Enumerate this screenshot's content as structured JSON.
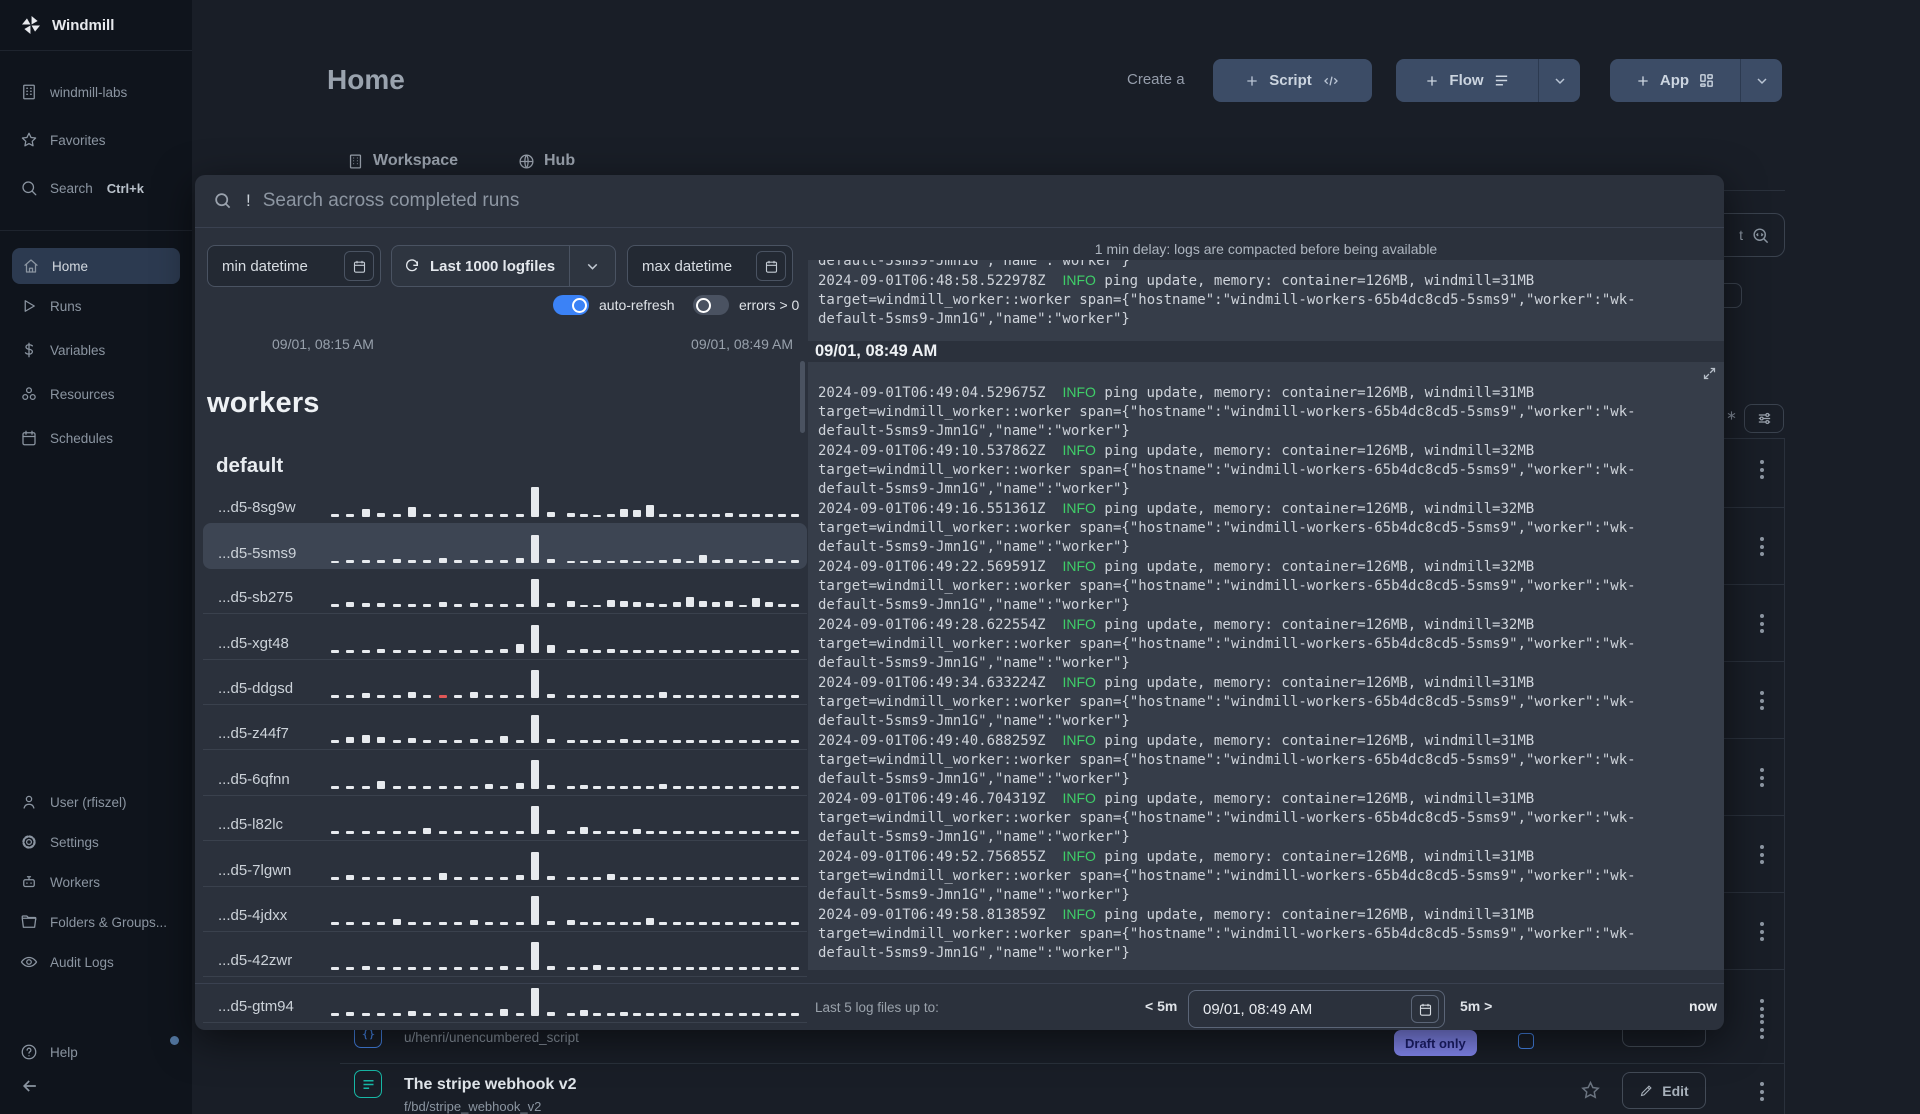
{
  "sidebar": {
    "logo_label": "Windmill",
    "top_items": [
      {
        "icon": "building",
        "label": "windmill-labs"
      },
      {
        "icon": "star",
        "label": "Favorites"
      },
      {
        "icon": "search",
        "label": "Search",
        "kbd": "Ctrl+k"
      }
    ],
    "main_items": [
      {
        "icon": "home",
        "label": "Home",
        "active": true
      },
      {
        "icon": "play",
        "label": "Runs"
      },
      {
        "icon": "dollar",
        "label": "Variables"
      },
      {
        "icon": "resources",
        "label": "Resources"
      },
      {
        "icon": "calendar",
        "label": "Schedules"
      }
    ],
    "bottom_items": [
      {
        "icon": "user",
        "label": "User (rfiszel)"
      },
      {
        "icon": "gear",
        "label": "Settings"
      },
      {
        "icon": "robot",
        "label": "Workers"
      },
      {
        "icon": "folder",
        "label": "Folders & Groups..."
      },
      {
        "icon": "eye",
        "label": "Audit Logs"
      }
    ],
    "help_label": "Help"
  },
  "header": {
    "title": "Home",
    "create_label": "Create a",
    "script_label": "Script",
    "flow_label": "Flow",
    "app_label": "App"
  },
  "tabs": {
    "workspace": "Workspace",
    "hub": "Hub"
  },
  "background": {
    "search_char": "t",
    "row_a_path": "u/henri/unencumbered_script",
    "row_a_badge": "Draft only",
    "row_b_title": "The stripe webhook v2",
    "row_b_path": "f/bd/stripe_webhook_v2",
    "edit_label": "Edit"
  },
  "modal": {
    "search_prefix": "!",
    "search_placeholder": "Search across completed runs",
    "filters": {
      "min_label": "min datetime",
      "logfiles_label": "Last 1000 logfiles",
      "max_label": "max datetime"
    },
    "toggles": {
      "auto_label": "auto-refresh",
      "errors_label": "errors > 0"
    },
    "range": {
      "start": "09/01, 08:15 AM",
      "end": "09/01, 08:49 AM"
    },
    "workers_title": "workers",
    "group_title": "default",
    "workers": [
      {
        "name": "...d5-8sg9w",
        "bars": [
          3,
          3,
          8,
          4,
          3,
          10,
          3,
          3,
          3,
          3,
          3,
          3,
          3,
          30,
          5,
          4,
          3,
          2,
          3,
          8,
          7,
          12,
          3,
          3,
          3,
          3,
          3,
          4,
          3,
          3,
          3,
          3,
          3
        ]
      },
      {
        "name": "...d5-5sms9",
        "highlight": true,
        "bars": [
          2,
          3,
          3,
          3,
          4,
          3,
          3,
          5,
          3,
          3,
          3,
          3,
          5,
          28,
          4,
          2,
          2,
          3,
          2,
          3,
          2,
          2,
          3,
          4,
          2,
          8,
          3,
          4,
          3,
          2,
          4,
          2,
          3
        ]
      },
      {
        "name": "...d5-sb275",
        "bars": [
          3,
          5,
          4,
          4,
          3,
          3,
          3,
          5,
          3,
          4,
          3,
          3,
          3,
          28,
          4,
          6,
          2,
          2,
          7,
          6,
          5,
          4,
          3,
          5,
          10,
          6,
          5,
          6,
          2,
          9,
          5,
          3,
          3
        ]
      },
      {
        "name": "...d5-xgt48",
        "bars": [
          3,
          3,
          3,
          4,
          3,
          3,
          3,
          3,
          3,
          3,
          3,
          4,
          9,
          28,
          8,
          3,
          4,
          3,
          4,
          3,
          3,
          3,
          3,
          3,
          3,
          3,
          3,
          3,
          3,
          3,
          3,
          3,
          3
        ]
      },
      {
        "name": "...d5-ddgsd",
        "err": 7,
        "bars": [
          3,
          3,
          5,
          3,
          3,
          6,
          3,
          3,
          3,
          6,
          3,
          3,
          3,
          28,
          4,
          3,
          3,
          3,
          3,
          3,
          3,
          3,
          6,
          3,
          3,
          3,
          3,
          3,
          3,
          3,
          3,
          3,
          3
        ]
      },
      {
        "name": "...d5-z44f7",
        "bars": [
          3,
          6,
          8,
          6,
          3,
          5,
          3,
          3,
          3,
          4,
          3,
          7,
          3,
          28,
          4,
          3,
          3,
          3,
          3,
          4,
          3,
          3,
          3,
          3,
          3,
          3,
          3,
          3,
          3,
          3,
          3,
          3,
          3
        ]
      },
      {
        "name": "...d5-6qfnn",
        "bars": [
          3,
          3,
          3,
          8,
          3,
          3,
          3,
          3,
          3,
          3,
          5,
          3,
          6,
          29,
          4,
          3,
          4,
          3,
          3,
          3,
          3,
          3,
          5,
          3,
          3,
          3,
          3,
          3,
          3,
          3,
          3,
          3,
          3
        ]
      },
      {
        "name": "...d5-l82lc",
        "bars": [
          3,
          3,
          3,
          3,
          3,
          3,
          6,
          3,
          3,
          3,
          3,
          3,
          3,
          28,
          4,
          3,
          7,
          3,
          3,
          3,
          5,
          3,
          3,
          3,
          3,
          3,
          3,
          3,
          3,
          3,
          3,
          3,
          3
        ]
      },
      {
        "name": "...d5-7lgwn",
        "bars": [
          3,
          5,
          3,
          3,
          3,
          3,
          3,
          7,
          3,
          3,
          3,
          3,
          5,
          28,
          4,
          3,
          3,
          3,
          6,
          3,
          3,
          3,
          3,
          3,
          3,
          3,
          3,
          3,
          3,
          3,
          3,
          3,
          3
        ]
      },
      {
        "name": "...d5-4jdxx",
        "bars": [
          3,
          3,
          3,
          3,
          6,
          3,
          3,
          3,
          3,
          5,
          3,
          3,
          3,
          29,
          4,
          5,
          3,
          3,
          3,
          3,
          3,
          7,
          3,
          3,
          3,
          3,
          3,
          3,
          3,
          3,
          3,
          3,
          3
        ]
      },
      {
        "name": "...d5-42zwr",
        "bars": [
          3,
          3,
          4,
          3,
          3,
          3,
          3,
          3,
          3,
          3,
          3,
          4,
          3,
          28,
          4,
          3,
          3,
          5,
          3,
          3,
          3,
          3,
          3,
          3,
          3,
          3,
          3,
          3,
          3,
          3,
          3,
          3,
          3
        ]
      },
      {
        "name": "...d5-gtm94",
        "bars": [
          3,
          4,
          3,
          3,
          3,
          5,
          3,
          3,
          3,
          3,
          3,
          7,
          3,
          28,
          4,
          3,
          6,
          3,
          3,
          4,
          3,
          3,
          3,
          3,
          3,
          3,
          3,
          3,
          3,
          3,
          3,
          3,
          3
        ]
      }
    ],
    "logs": {
      "delay_note": "1 min delay: logs are compacted before being available",
      "section_header": "09/01, 08:49 AM",
      "info_label": "INFO",
      "line1_mid": " ping update, memory: container=126MB, windmill=",
      "line2": "target=windmill_worker::worker span={\"hostname\":\"windmill-workers-65b4dc8cd5-5sms9\",\"worker\":\"wk-",
      "line3": "default-5sms9-Jmn1G\",\"name\":\"worker\"}",
      "top_entry": {
        "ts": "2024-09-01T06:48:58.522978Z",
        "mem": "31MB"
      },
      "entries": [
        {
          "ts": "2024-09-01T06:49:04.529675Z",
          "mem": "31MB"
        },
        {
          "ts": "2024-09-01T06:49:10.537862Z",
          "mem": "32MB"
        },
        {
          "ts": "2024-09-01T06:49:16.551361Z",
          "mem": "32MB"
        },
        {
          "ts": "2024-09-01T06:49:22.569591Z",
          "mem": "32MB"
        },
        {
          "ts": "2024-09-01T06:49:28.622554Z",
          "mem": "32MB"
        },
        {
          "ts": "2024-09-01T06:49:34.633224Z",
          "mem": "31MB"
        },
        {
          "ts": "2024-09-01T06:49:40.688259Z",
          "mem": "31MB"
        },
        {
          "ts": "2024-09-01T06:49:46.704319Z",
          "mem": "31MB"
        },
        {
          "ts": "2024-09-01T06:49:52.756855Z",
          "mem": "31MB"
        },
        {
          "ts": "2024-09-01T06:49:58.813859Z",
          "mem": "31MB"
        }
      ]
    },
    "footer": {
      "label": "Last 5 log files up to:",
      "back": "< 5m",
      "datetime": "09/01, 08:49 AM",
      "fwd": "5m >",
      "now": "now"
    }
  }
}
